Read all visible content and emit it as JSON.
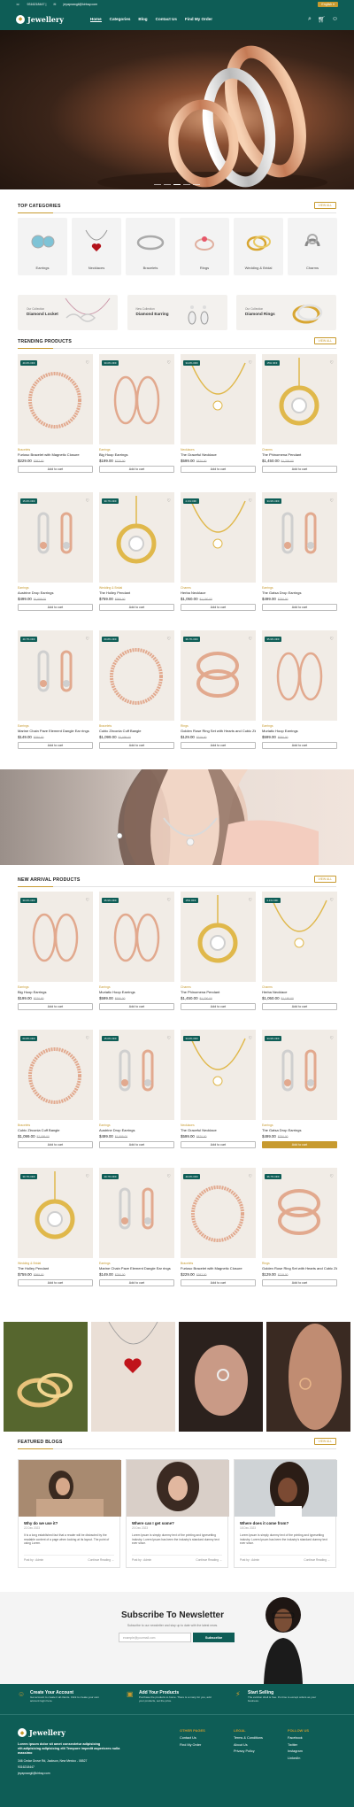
{
  "topbar": {
    "phone": "9316218447 |",
    "email": "jeyaprawgii@kirbay.com",
    "lang": "English"
  },
  "brand": {
    "name": "Jewellery",
    "accent": "#c79a2f",
    "primary": "#0e5d56"
  },
  "nav": [
    "Home",
    "Categories",
    "Blog",
    "Contact Us",
    "Find My Order"
  ],
  "top_categories": {
    "title": "TOP CATEGORIES",
    "view_all": "VIEW ALL",
    "items": [
      "Earrings",
      "Necklaces",
      "Bracelets",
      "Rings",
      "Wedding & Bridal",
      "Charms"
    ],
    "promos": [
      {
        "small": "Our Collection",
        "big": "Diamond Locket"
      },
      {
        "small": "New Collection",
        "big": "Diamond Earring"
      },
      {
        "small": "Our Collection",
        "big": "Diamond Rings"
      }
    ]
  },
  "trending": {
    "title": "TRENDING PRODUCTS",
    "view_all": "VIEW ALL",
    "items": [
      {
        "badge": "40.0% OFF",
        "cat": "Bracelets",
        "name": "Furioso Bracelet with Magnetic Closure",
        "price": "$229.00",
        "old": "$382.00"
      },
      {
        "badge": "30.0% OFF",
        "cat": "Earrings",
        "name": "Big Hoop Earrings",
        "price": "$199.00",
        "old": "$270.00"
      },
      {
        "badge": "34.0% OFF",
        "cat": "Necklaces",
        "name": "The Graceful Necklace",
        "price": "$599.00",
        "old": "$870.00"
      },
      {
        "badge": "15% OFF",
        "cat": "Charms",
        "name": "The Phinomena Pendant",
        "price": "$1,450.00",
        "old": "$1,700.00"
      },
      {
        "badge": "15.0% OFF",
        "cat": "Earrings",
        "name": "Austrine Drop Earrings",
        "price": "$499.00",
        "old": "$1,999.00"
      },
      {
        "badge": "30.7% OFF",
        "cat": "Wedding & Bridal",
        "name": "The Holley Pendant",
        "price": "$759.00",
        "old": "$999.00"
      },
      {
        "badge": "2.1% OFF",
        "cat": "Charms",
        "name": "Herba Necklace",
        "price": "$1,050.00",
        "old": "$1,150.00"
      },
      {
        "badge": "34.9% OFF",
        "cat": "Earrings",
        "name": "The Gatsa Drop Earrings",
        "price": "$499.00",
        "old": "$750.00"
      },
      {
        "badge": "40.7% OFF",
        "cat": "Earrings",
        "name": "Marine Chain Pave Element Dangle Ear rings",
        "price": "$149.00",
        "old": "$250.00"
      },
      {
        "badge": "60.8% OFF",
        "cat": "Bracelets",
        "name": "Cubic Zirconia Cuff Bangle",
        "price": "$1,099.00",
        "old": "$2,099.00"
      },
      {
        "badge": "36.7% OFF",
        "cat": "Rings",
        "name": "Golden Rose Ring Set with Hearts and Cubic Zirconia",
        "price": "$129.00",
        "old": "$219.00"
      },
      {
        "badge": "35.9% OFF",
        "cat": "Earrings",
        "name": "Muriatic Hoop Earrings",
        "price": "$599.00",
        "old": "$930.00"
      }
    ],
    "add_label": "Add to cart"
  },
  "new_arrival": {
    "title": "NEW ARRIVAL PRODUCTS",
    "view_all": "VIEW ALL",
    "items": [
      {
        "badge": "30.0% OFF",
        "cat": "Earrings",
        "name": "Big Hoop Earrings",
        "price": "$199.00",
        "old": "$270.00"
      },
      {
        "badge": "35.9% OFF",
        "cat": "Earrings",
        "name": "Muriatic Hoop Earrings",
        "price": "$599.00",
        "old": "$930.00"
      },
      {
        "badge": "15% OFF",
        "cat": "Charms",
        "name": "The Phinomena Pendant",
        "price": "$1,450.00",
        "old": "$1,700.00"
      },
      {
        "badge": "2.1% OFF",
        "cat": "Charms",
        "name": "Herba Necklace",
        "price": "$1,050.00",
        "old": "$1,150.00"
      },
      {
        "badge": "60.8% OFF",
        "cat": "Bracelets",
        "name": "Cubic Zirconia Cuff Bangle",
        "price": "$1,099.00",
        "old": "$2,099.00"
      },
      {
        "badge": "15.0% OFF",
        "cat": "Earrings",
        "name": "Austrine Drop Earrings",
        "price": "$499.00",
        "old": "$1,999.00"
      },
      {
        "badge": "34.0% OFF",
        "cat": "Necklaces",
        "name": "The Graceful Necklace",
        "price": "$599.00",
        "old": "$870.00"
      },
      {
        "badge": "34.9% OFF",
        "cat": "Earrings",
        "name": "The Gatsa Drop Earrings",
        "price": "$499.00",
        "old": "$750.00"
      },
      {
        "badge": "30.7% OFF",
        "cat": "Wedding & Bridal",
        "name": "The Holley Pendant",
        "price": "$759.00",
        "old": "$999.00"
      },
      {
        "badge": "40.7% OFF",
        "cat": "Earrings",
        "name": "Marine Chain Pave Element Dangle Ear rings",
        "price": "$149.00",
        "old": "$250.00"
      },
      {
        "badge": "40.0% OFF",
        "cat": "Bracelets",
        "name": "Furioso Bracelet with Magnetic Closure",
        "price": "$229.00",
        "old": "$382.00"
      },
      {
        "badge": "36.7% OFF",
        "cat": "Rings",
        "name": "Golden Rose Ring Set with Hearts and Cubic Zirconia",
        "price": "$129.00",
        "old": "$219.00"
      }
    ]
  },
  "blogs": {
    "title": "FEATURED BLOGS",
    "view_all": "VIEW ALL",
    "items": [
      {
        "title": "Why do we use it?",
        "date": "22 Dec 2023",
        "text": "It is a long established fact that a reader will be distracted by the readable content of a page when looking at its layout. The point of using Lorem.",
        "by": "Post by : Admin",
        "more": "Continue Reading →"
      },
      {
        "title": "Where can I get some?",
        "date": "20 Dec 2023",
        "text": "Lorem Ipsum is simply dummy text of the printing and typesetting industry. Lorem Ipsum has been the industry's standard dummy text ever since.",
        "by": "Post by : Admin",
        "more": "Continue Reading →"
      },
      {
        "title": "Where does it come from?",
        "date": "18 Dec 2023",
        "text": "Lorem Ipsum is simply dummy text of the printing and typesetting industry. Lorem Ipsum has been the industry's standard dummy text ever since.",
        "by": "Post by : Admin",
        "more": "Continue Reading →"
      }
    ]
  },
  "newsletter": {
    "title": "Subscribe To Newsletter",
    "sub": "Subscribe to our newsletter and stay up to date with the latest news.",
    "placeholder": "example@yourmail.com",
    "button": "Subscribe"
  },
  "features": [
    {
      "title": "Create Your Account",
      "desc": "Get account to create it all clients. Click to create your own account login here."
    },
    {
      "title": "Add Your Products",
      "desc": "Purchase the products to home. There is a many for you, add your products, set the price."
    },
    {
      "title": "Start Selling",
      "desc": "The eviction shell is free. It's time to except orders as your business."
    }
  ],
  "footer": {
    "brand": "Jewellery",
    "about": "Lorem ipsum dolor sit amet consectetur adipisicing elit.adipisicing adipisicing elit Tempore impedit asperiores nulla massimo",
    "address": "346 Cedar Grove Rd, Jackson, New Mexico - 08527",
    "phone": "9316218447",
    "email": "jeyaprawgii@kirbay.com",
    "cols": [
      {
        "head": "OTHER PAGES",
        "items": [
          "Contact Us",
          "Find My Order"
        ]
      },
      {
        "head": "LEGAL",
        "items": [
          "Terms & Conditions",
          "About Us",
          "Privacy Policy"
        ]
      },
      {
        "head": "FOLLOW US",
        "items": [
          "Facebook",
          "Twitter",
          "Instagram",
          "LinkedIn"
        ]
      }
    ]
  }
}
